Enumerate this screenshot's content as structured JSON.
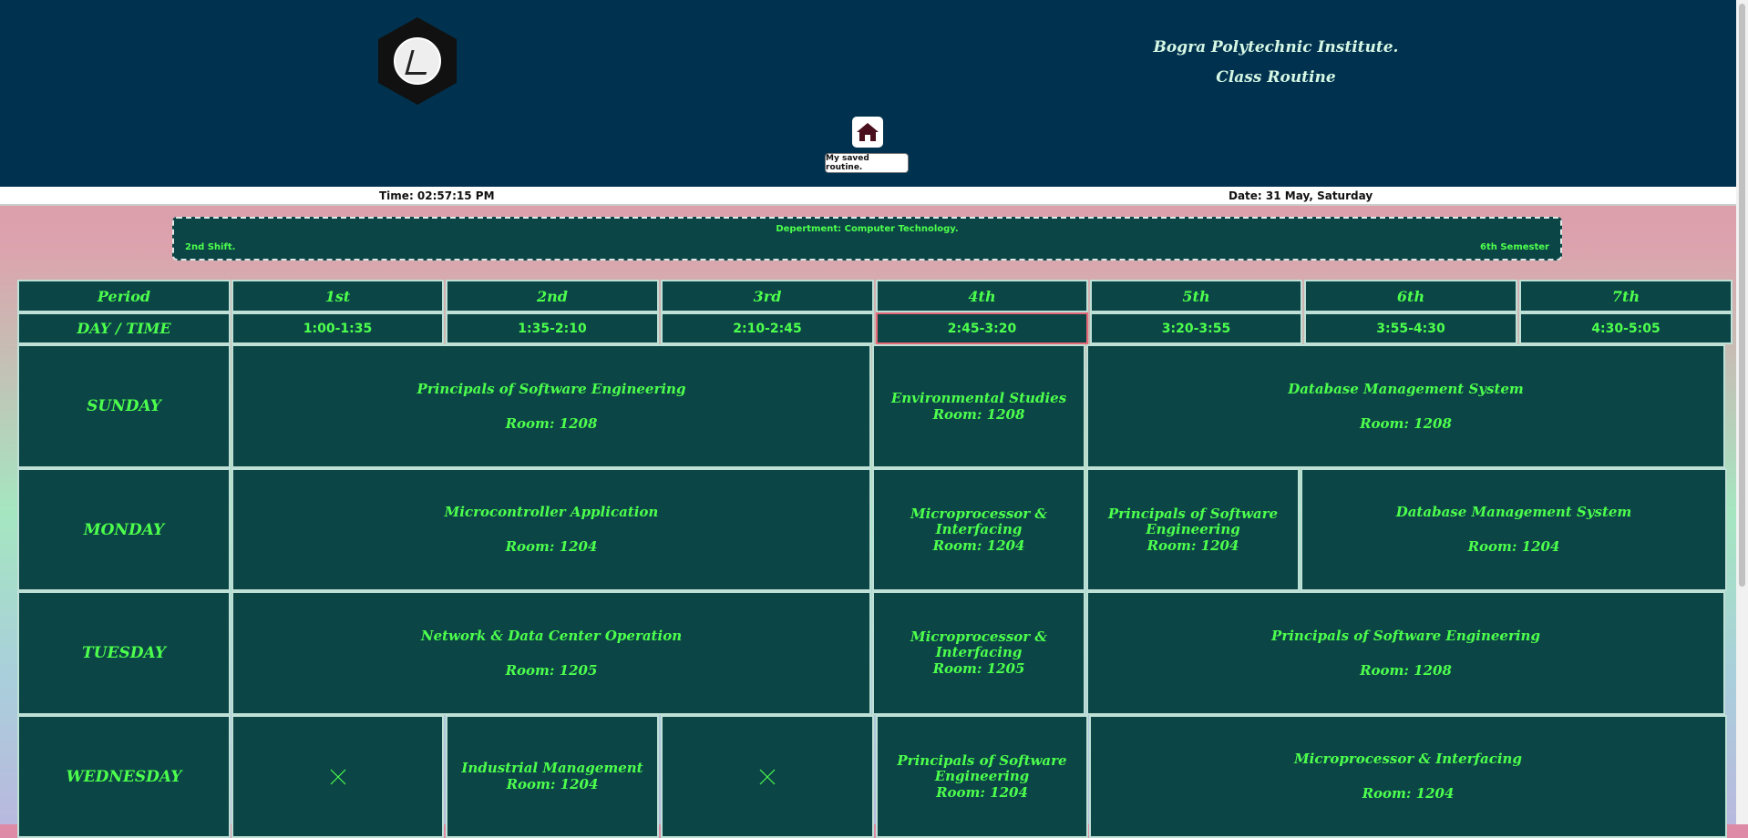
{
  "header": {
    "institute": "Bogra Polytechnic Institute.",
    "subtitle": "Class Routine",
    "home_icon": "home-icon",
    "saved_label": "My saved routine."
  },
  "info": {
    "time": "Time: 02:57:15 PM",
    "date": "Date: 31 May, Saturday"
  },
  "dept": {
    "department": "Depertment: Computer Technology.",
    "shift": "2nd Shift.",
    "semester": "6th Semester"
  },
  "table": {
    "period_label": "Period",
    "daytime_label": "DAY / TIME",
    "periods": [
      "1st",
      "2nd",
      "3rd",
      "4th",
      "5th",
      "6th",
      "7th"
    ],
    "times": [
      "1:00-1:35",
      "1:35-2:10",
      "2:10-2:45",
      "2:45-3:20",
      "3:20-3:55",
      "3:55-4:30",
      "4:30-5:05"
    ],
    "days": {
      "sunday": {
        "name": "SUNDAY",
        "classes": [
          {
            "subject": "Principals of Software Engineering",
            "room": "Room: 1208"
          },
          {
            "subject": "Environmental Studies",
            "room": "Room: 1208"
          },
          {
            "subject": "Database Management System",
            "room": "Room: 1208"
          }
        ]
      },
      "monday": {
        "name": "MONDAY",
        "classes": [
          {
            "subject": "Microcontroller Application",
            "room": "Room: 1204"
          },
          {
            "subject": "Microprocessor & Interfacing",
            "room": "Room: 1204"
          },
          {
            "subject": "Principals of Software Engineering",
            "room": "Room: 1204"
          },
          {
            "subject": "Database Management System",
            "room": "Room: 1204"
          }
        ]
      },
      "tuesday": {
        "name": "TUESDAY",
        "classes": [
          {
            "subject": "Network & Data Center Operation",
            "room": "Room: 1205"
          },
          {
            "subject": "Microprocessor & Interfacing",
            "room": "Room: 1205"
          },
          {
            "subject": "Principals of Software Engineering",
            "room": "Room: 1208"
          }
        ]
      },
      "wednesday": {
        "name": "WEDNESDAY",
        "classes": [
          {
            "subject": "Industrial Management",
            "room": "Room: 1204"
          },
          {
            "subject": "Principals of Software Engineering",
            "room": "Room: 1204"
          },
          {
            "subject": "Microprocessor & Interfacing",
            "room": "Room: 1204"
          }
        ],
        "empty_icon": "x-icon"
      }
    }
  },
  "colors": {
    "header_bg": "#00324f",
    "cell_bg": "#0b4545",
    "text_green": "#4dff4d",
    "highlight_border": "#e46a7a"
  }
}
